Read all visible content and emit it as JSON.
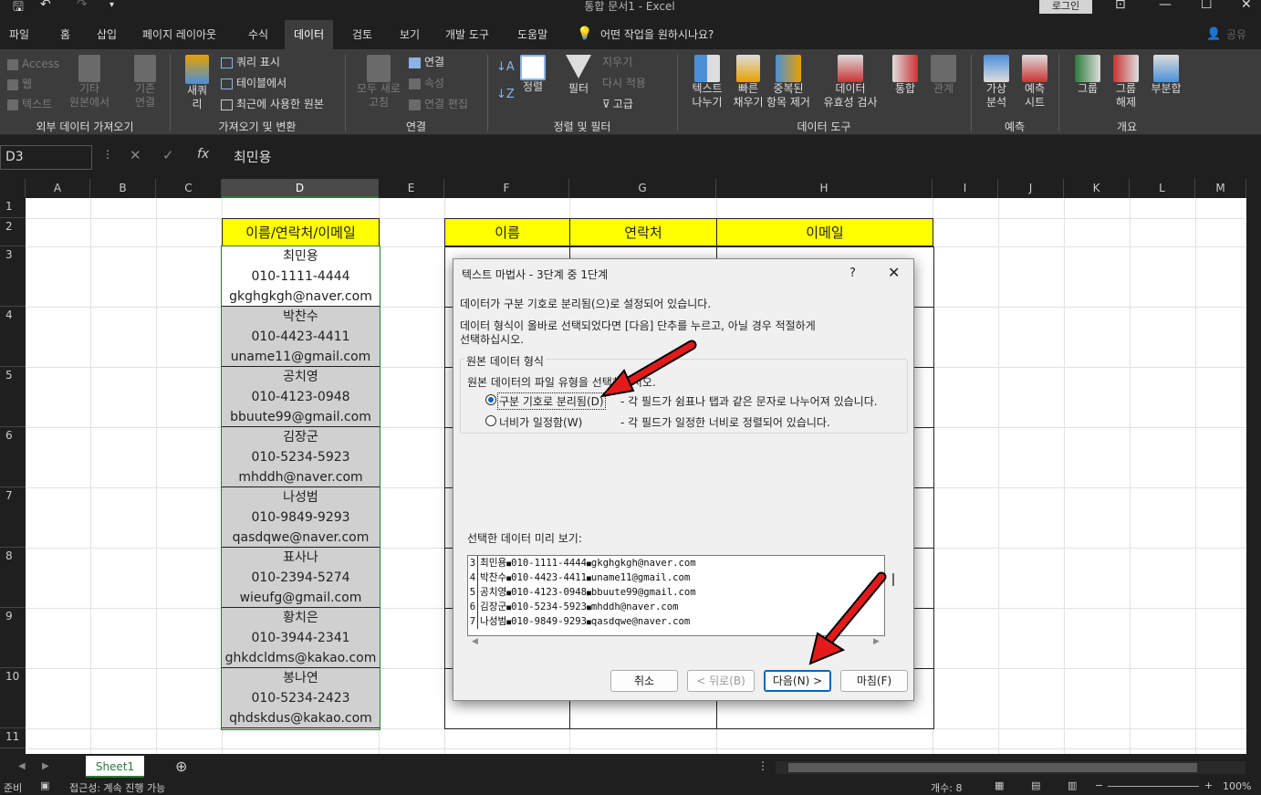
{
  "titlebar": {
    "title": "통합 문서1 - Excel",
    "login": "로그인"
  },
  "tabs": [
    "파일",
    "홈",
    "삽입",
    "페이지 레이아웃",
    "수식",
    "데이터",
    "검토",
    "보기",
    "개발 도구",
    "도움말"
  ],
  "tell_me": "어떤 작업을 원하시나요?",
  "share": "공유",
  "ribbon": {
    "ext_access": "Access",
    "ext_web": "웹",
    "ext_text": "텍스트",
    "ext_other": "기타\n원본에서",
    "ext_conn": "기존\n연결",
    "new_query": "새쿼\n리",
    "query_show": "쿼리 표시",
    "from_table": "테이블에서",
    "recent": "최근에 사용한 원본",
    "refresh_all": "모두 새로\n고침",
    "conn": "연결",
    "props": "속성",
    "edit_links": "연결 편집",
    "sort": "정렬",
    "filter": "필터",
    "clear": "지우기",
    "reapply": "다시 적용",
    "advanced": "고급",
    "text_to_col": "텍스트\n나누기",
    "flash_fill": "빠른\n채우기",
    "remove_dup": "중복된\n항목 제거",
    "validation": "데이터\n유효성 검사",
    "consolidate": "통합",
    "relations": "관계",
    "whatif": "가상\n분석",
    "forecast": "예측\n시트",
    "group": "그룹",
    "ungroup": "그룹\n해제",
    "subtotal": "부분합",
    "groups": [
      "외부 데이터 가져오기",
      "가져오기 및 변환",
      "연결",
      "정렬 및 필터",
      "데이터 도구",
      "예측",
      "개요"
    ]
  },
  "namebox": "D3",
  "formula": "최민용",
  "columns": [
    "A",
    "B",
    "C",
    "D",
    "E",
    "F",
    "G",
    "H",
    "I",
    "J",
    "K",
    "L",
    "M"
  ],
  "rows": [
    "1",
    "2",
    "3",
    "4",
    "5",
    "6",
    "7",
    "8",
    "9",
    "10",
    "11"
  ],
  "header_d": "이름/연락처/이메일",
  "header_f": "이름",
  "header_g": "연락처",
  "header_h": "이메일",
  "entries": [
    {
      "name": "최민용",
      "phone": "010-1111-4444",
      "email": "gkghgkgh@naver.com"
    },
    {
      "name": "박찬수",
      "phone": "010-4423-4411",
      "email": "uname11@gmail.com"
    },
    {
      "name": "공치영",
      "phone": "010-4123-0948",
      "email": "bbuute99@gmail.com"
    },
    {
      "name": "김장군",
      "phone": "010-5234-5923",
      "email": "mhddh@naver.com"
    },
    {
      "name": "나성범",
      "phone": "010-9849-9293",
      "email": "qasdqwe@naver.com"
    },
    {
      "name": "표사나",
      "phone": "010-2394-5274",
      "email": "wieufg@gmail.com"
    },
    {
      "name": "황치은",
      "phone": "010-3944-2341",
      "email": "ghkdcldms@kakao.com"
    },
    {
      "name": "봉나연",
      "phone": "010-5234-2423",
      "email": "qhdskdus@kakao.com"
    }
  ],
  "dialog": {
    "title": "텍스트 마법사 - 3단계 중 1단계",
    "help": "?",
    "line1": "데이터가 구분 기호로 분리됨(으)로 설정되어 있습니다.",
    "line2": "데이터 형식이 올바로 선택되었다면 [다음] 단추를 누르고, 아닐 경우 적절하게",
    "line3": "선택하십시오.",
    "group_label": "원본 데이터 형식",
    "file_type": "원본 데이터의 파일 유형을 선택하십시오.",
    "opt1": "구분 기호로 분리됨(D)",
    "opt1_desc": "- 각 필드가 쉼표나 탭과 같은 문자로 나누어져 있습니다.",
    "opt2": "너비가 일정함(W)",
    "opt2_desc": "- 각 필드가 일정한 너비로 정렬되어 있습니다.",
    "preview_label": "선택한 데이터 미리 보기:",
    "preview": [
      {
        "n": "3",
        "a": "최민용",
        "b": "010-1111-4444",
        "c": "gkghgkgh@naver.com"
      },
      {
        "n": "4",
        "a": "박찬수",
        "b": "010-4423-4411",
        "c": "uname11@gmail.com"
      },
      {
        "n": "5",
        "a": "공치영",
        "b": "010-4123-0948",
        "c": "bbuute99@gmail.com"
      },
      {
        "n": "6",
        "a": "김장군",
        "b": "010-5234-5923",
        "c": "mhddh@naver.com"
      },
      {
        "n": "7",
        "a": "나성범",
        "b": "010-9849-9293",
        "c": "qasdqwe@naver.com"
      }
    ],
    "cancel": "취소",
    "back": "< 뒤로(B)",
    "next": "다음(N) >",
    "finish": "마침(F)"
  },
  "sheet_tab": "Sheet1",
  "status": {
    "ready": "준비",
    "accessibility": "접근성: 계속 진행 가능",
    "count": "개수: 8",
    "zoom": "100%"
  }
}
